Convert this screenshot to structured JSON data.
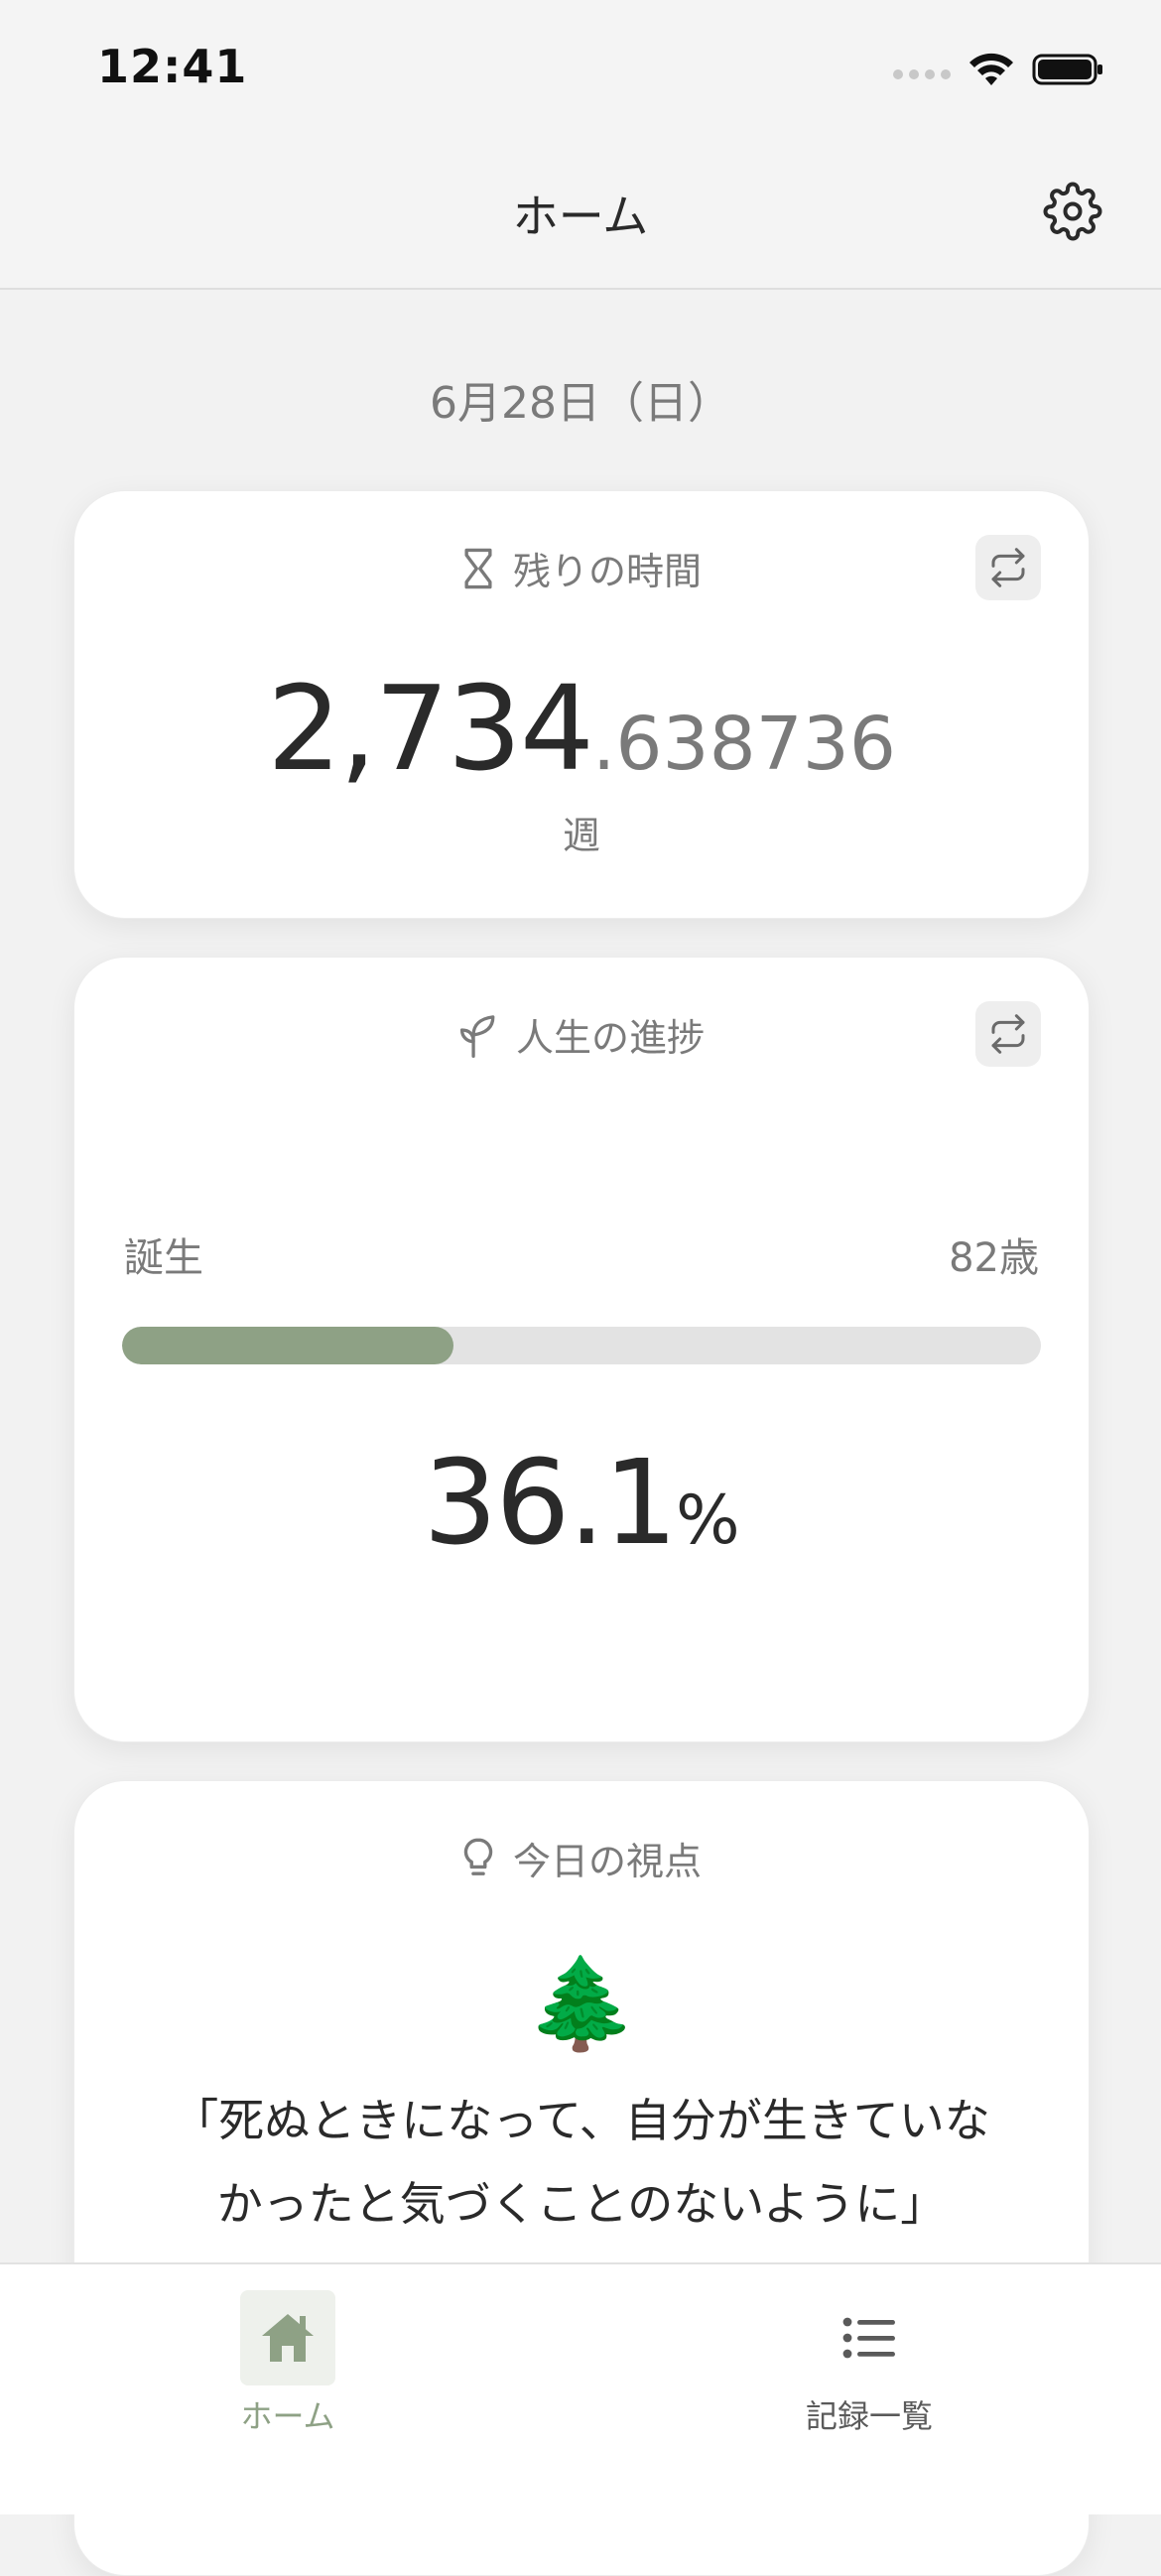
{
  "status_bar": {
    "time": "12:41"
  },
  "nav": {
    "title": "ホーム",
    "settings_icon": "gear-icon"
  },
  "date": "6月28日（日）",
  "remaining_card": {
    "title": "残りの時間",
    "icon": "hourglass-icon",
    "value_integer": "2,734",
    "value_decimal": ".638736",
    "unit": "週"
  },
  "progress_card": {
    "title": "人生の進捗",
    "icon": "sprout-icon",
    "start_label": "誕生",
    "end_label": "82歳",
    "percent_value": "36.1",
    "percent_sign": "%",
    "progress_fraction": 0.361
  },
  "quote_card": {
    "title": "今日の視点",
    "icon": "lightbulb-icon",
    "emoji": "🌲",
    "quote": "「死ぬときになって、自分が生きていなかったと気づくことのないように」"
  },
  "tabs": [
    {
      "label": "ホーム",
      "icon": "home-icon",
      "active": true
    },
    {
      "label": "記録一覧",
      "icon": "list-icon",
      "active": false
    }
  ],
  "colors": {
    "accent": "#8ea185",
    "background": "#f2f2f2",
    "card": "#ffffff"
  }
}
